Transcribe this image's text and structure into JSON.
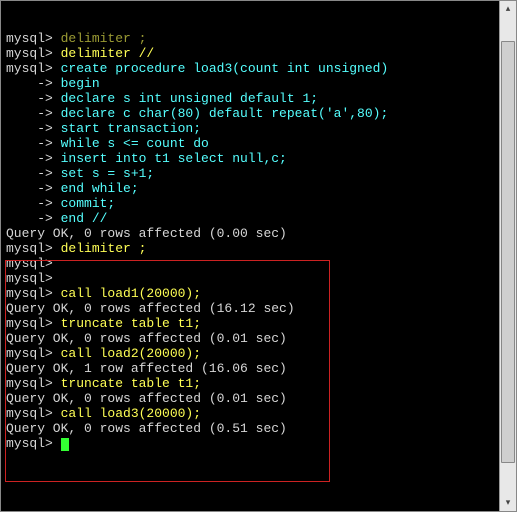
{
  "lines": [
    {
      "prompt": "mysql>",
      "cmd": " delimiter ;",
      "style": "cmd-faint"
    },
    {
      "prompt": "mysql>",
      "cmd": " delimiter //",
      "style": "cmd"
    },
    {
      "prompt": "mysql>",
      "cmd": " create procedure load3(count int unsigned)",
      "style": "kw"
    },
    {
      "prompt": "    ->",
      "cmd": " begin",
      "style": "kw"
    },
    {
      "prompt": "    ->",
      "cmd": " declare s int unsigned default 1;",
      "style": "kw"
    },
    {
      "prompt": "    ->",
      "cmd": " declare c char(80) default repeat('a',80);",
      "style": "kw"
    },
    {
      "prompt": "    ->",
      "cmd": " start transaction;",
      "style": "kw"
    },
    {
      "prompt": "    ->",
      "cmd": " while s <= count do",
      "style": "kw"
    },
    {
      "prompt": "    ->",
      "cmd": " insert into t1 select null,c;",
      "style": "kw"
    },
    {
      "prompt": "    ->",
      "cmd": " set s = s+1;",
      "style": "kw"
    },
    {
      "prompt": "    ->",
      "cmd": " end while;",
      "style": "kw"
    },
    {
      "prompt": "    ->",
      "cmd": " commit;",
      "style": "kw"
    },
    {
      "prompt": "    ->",
      "cmd": " end //",
      "style": "kw"
    },
    {
      "output": "Query OK, 0 rows affected (0.00 sec)"
    },
    {
      "output": ""
    },
    {
      "prompt": "mysql>",
      "cmd": " delimiter ;",
      "style": "cmd"
    },
    {
      "prompt": "mysql>",
      "cmd": "",
      "style": "cmd"
    },
    {
      "prompt": "mysql>",
      "cmd": "",
      "style": "cmd"
    },
    {
      "prompt": "mysql>",
      "cmd": " call load1(20000);",
      "style": "cmd"
    },
    {
      "output": "Query OK, 0 rows affected (16.12 sec)"
    },
    {
      "output": ""
    },
    {
      "prompt": "mysql>",
      "cmd": " truncate table t1;",
      "style": "cmd"
    },
    {
      "output": "Query OK, 0 rows affected (0.01 sec)"
    },
    {
      "output": ""
    },
    {
      "prompt": "mysql>",
      "cmd": " call load2(20000);",
      "style": "cmd"
    },
    {
      "output": "Query OK, 1 row affected (16.06 sec)"
    },
    {
      "output": ""
    },
    {
      "prompt": "mysql>",
      "cmd": " truncate table t1;",
      "style": "cmd"
    },
    {
      "output": "Query OK, 0 rows affected (0.01 sec)"
    },
    {
      "output": ""
    },
    {
      "prompt": "mysql>",
      "cmd": " call load3(20000);",
      "style": "cmd"
    },
    {
      "output": "Query OK, 0 rows affected (0.51 sec)"
    },
    {
      "output": ""
    },
    {
      "prompt": "mysql>",
      "cmd": " ",
      "style": "cmd",
      "cursor": true
    }
  ]
}
